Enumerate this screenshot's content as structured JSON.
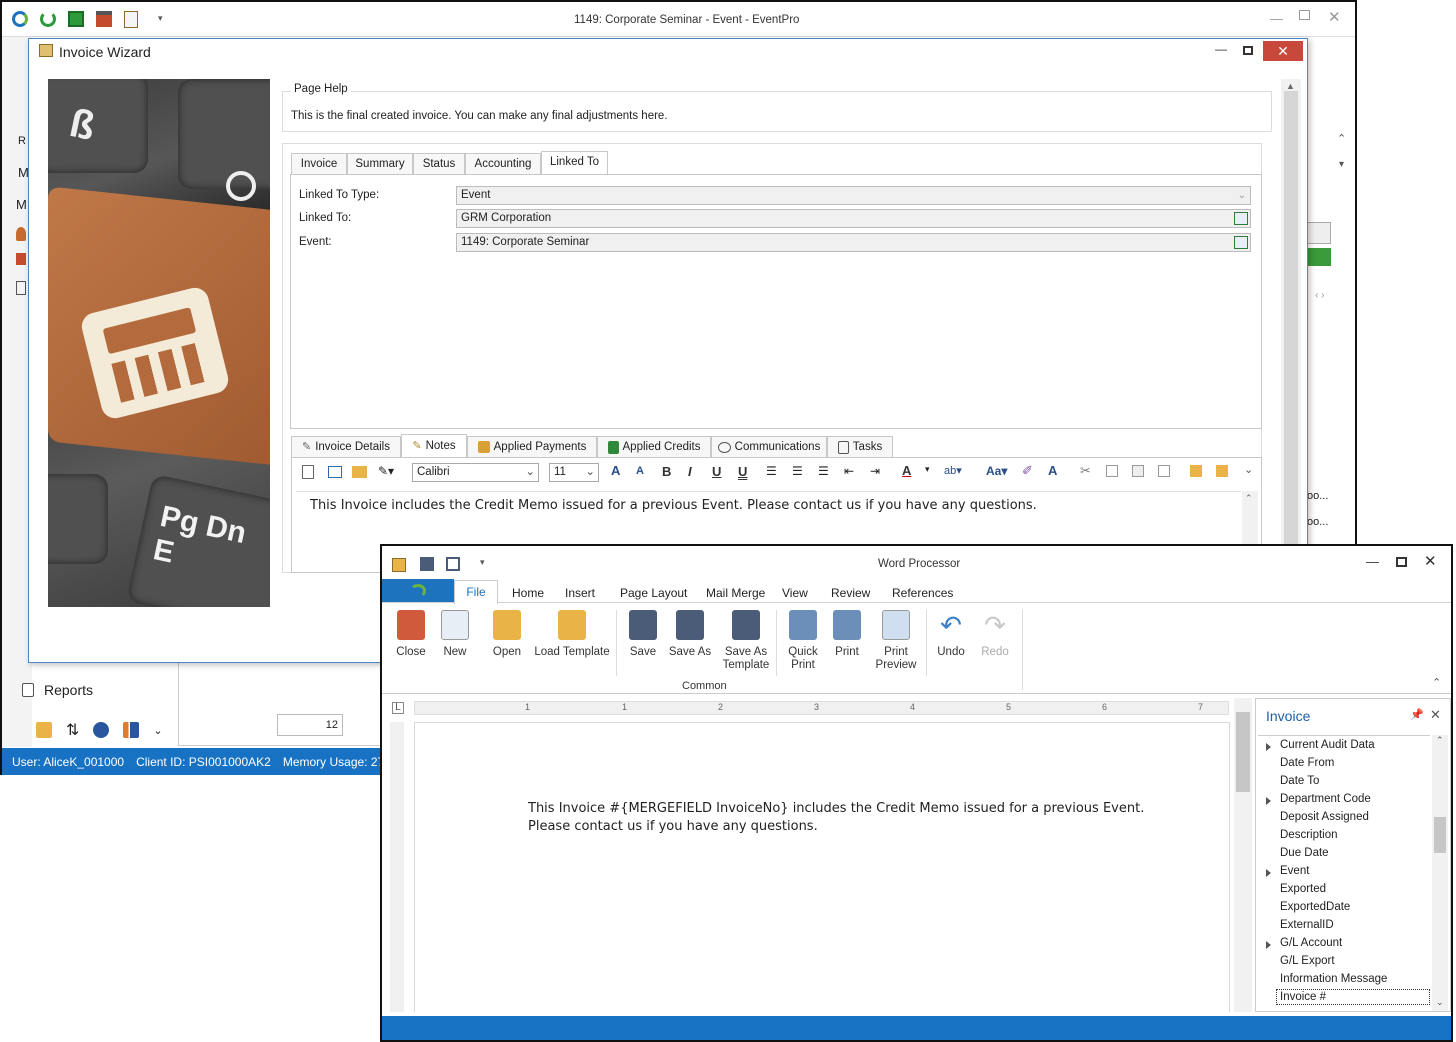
{
  "main_window": {
    "title": "1149: Corporate Seminar - Event - EventPro",
    "reports_label": "Reports",
    "page_value": "12",
    "status": {
      "user": "User: AliceK_001000",
      "client": "Client ID: PSI001000AK2",
      "memory": "Memory Usage: 273MB"
    },
    "sidebar_letters": [
      "R",
      "M",
      "M"
    ],
    "right_cells": [
      "oo...",
      "oo..."
    ]
  },
  "wizard": {
    "title": "Invoice Wizard",
    "page_help_label": "Page Help",
    "page_help_text": "This is the final created invoice.  You can make any final adjustments here.",
    "top_tabs": [
      "Invoice",
      "Summary",
      "Status",
      "Accounting",
      "Linked To"
    ],
    "fields": [
      {
        "label": "Linked To Type:",
        "value": "Event"
      },
      {
        "label": "Linked To:",
        "value": "GRM Corporation"
      },
      {
        "label": "Event:",
        "value": "1149: Corporate Seminar"
      }
    ],
    "bottom_tabs": [
      "Invoice Details",
      "Notes",
      "Applied Payments",
      "Applied Credits",
      "Communications",
      "Tasks"
    ],
    "font_name": "Calibri",
    "font_size": "11",
    "note_text": "This Invoice includes the Credit Memo issued for a previous Event. Please contact us if you have any questions."
  },
  "word_processor": {
    "title": "Word Processor",
    "tabs": [
      "File",
      "Home",
      "Insert",
      "Page Layout",
      "Mail Merge",
      "View",
      "Review",
      "References"
    ],
    "buttons": [
      {
        "label": "Close",
        "icon": "close-doc-icon",
        "color": "#d05a3c"
      },
      {
        "label": "New",
        "icon": "new-doc-icon",
        "color": "#e8eef6"
      },
      {
        "label": "Open",
        "icon": "folder-icon",
        "color": "#e9b347"
      },
      {
        "label": "Load Template",
        "icon": "load-template-icon",
        "color": "#e9b347"
      },
      {
        "label": "Save",
        "icon": "save-icon",
        "color": "#4a5c78"
      },
      {
        "label": "Save As",
        "icon": "save-as-icon",
        "color": "#4a5c78"
      },
      {
        "label": "Save As\nTemplate",
        "icon": "save-template-icon",
        "color": "#4a5c78"
      },
      {
        "label": "Quick\nPrint",
        "icon": "quick-print-icon",
        "color": "#6b8fb8"
      },
      {
        "label": "Print",
        "icon": "print-icon",
        "color": "#6b8fb8"
      },
      {
        "label": "Print\nPreview",
        "icon": "print-preview-icon",
        "color": "#cfdff0"
      },
      {
        "label": "Undo",
        "icon": "undo-icon",
        "color": "#3b7fc4"
      },
      {
        "label": "Redo",
        "icon": "redo-icon",
        "color": "#c8c8c8"
      }
    ],
    "group_label": "Common",
    "document_text": "This Invoice #{MERGEFIELD InvoiceNo} includes the Credit Memo issued for a previous Event. Please contact us if you have any questions.",
    "ruler_numbers": [
      "1",
      "1",
      "2",
      "3",
      "4",
      "5",
      "6",
      "7"
    ],
    "panel_title": "Invoice",
    "fields": [
      {
        "name": "Current Audit Data",
        "expandable": true
      },
      {
        "name": "Date From",
        "expandable": false
      },
      {
        "name": "Date To",
        "expandable": false
      },
      {
        "name": "Department Code",
        "expandable": true
      },
      {
        "name": "Deposit Assigned",
        "expandable": false
      },
      {
        "name": "Description",
        "expandable": false
      },
      {
        "name": "Due Date",
        "expandable": false
      },
      {
        "name": "Event",
        "expandable": true
      },
      {
        "name": "Exported",
        "expandable": false
      },
      {
        "name": "ExportedDate",
        "expandable": false
      },
      {
        "name": "ExternalID",
        "expandable": false
      },
      {
        "name": "G/L Account",
        "expandable": true
      },
      {
        "name": "G/L Export",
        "expandable": false
      },
      {
        "name": "Information Message",
        "expandable": false
      },
      {
        "name": "Invoice #",
        "expandable": false,
        "selected": true
      }
    ]
  }
}
